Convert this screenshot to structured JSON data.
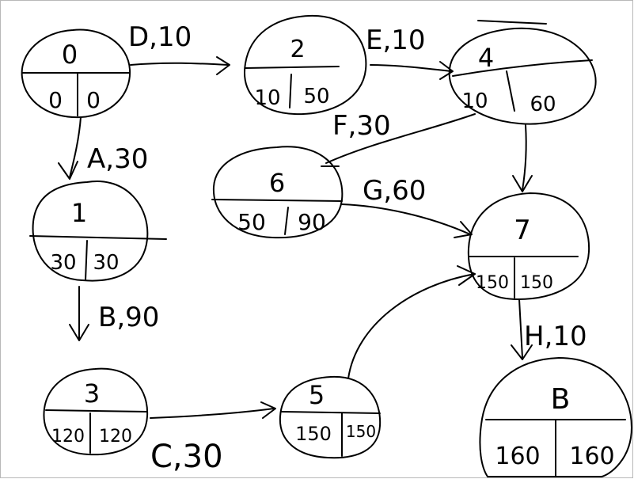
{
  "nodes": [
    {
      "id": "0",
      "label": "0",
      "left": "0",
      "right": "0"
    },
    {
      "id": "1",
      "label": "1",
      "left": "30",
      "right": "30"
    },
    {
      "id": "2",
      "label": "2",
      "left": "10",
      "right": "50"
    },
    {
      "id": "3",
      "label": "3",
      "left": "120",
      "right": "120"
    },
    {
      "id": "4",
      "label": "4",
      "left": "10",
      "right": "60"
    },
    {
      "id": "5",
      "label": "5",
      "left": "150",
      "right": "150"
    },
    {
      "id": "6",
      "label": "6",
      "left": "50",
      "right": "90"
    },
    {
      "id": "7",
      "label": "7",
      "left": "150",
      "right": "150"
    },
    {
      "id": "8",
      "label": "B",
      "left": "160",
      "right": "160"
    }
  ],
  "edges": [
    {
      "id": "e-0-2",
      "label": "D,10"
    },
    {
      "id": "e-0-1",
      "label": "A,30"
    },
    {
      "id": "e-2-4",
      "label": "E,10"
    },
    {
      "id": "e-4-6",
      "label": "F,30"
    },
    {
      "id": "e-4-7",
      "label": ""
    },
    {
      "id": "e-1-3",
      "label": "B,90"
    },
    {
      "id": "e-6-7",
      "label": "G,60"
    },
    {
      "id": "e-3-5",
      "label": "C,30"
    },
    {
      "id": "e-5-7",
      "label": ""
    },
    {
      "id": "e-7-8",
      "label": "H,10"
    }
  ]
}
